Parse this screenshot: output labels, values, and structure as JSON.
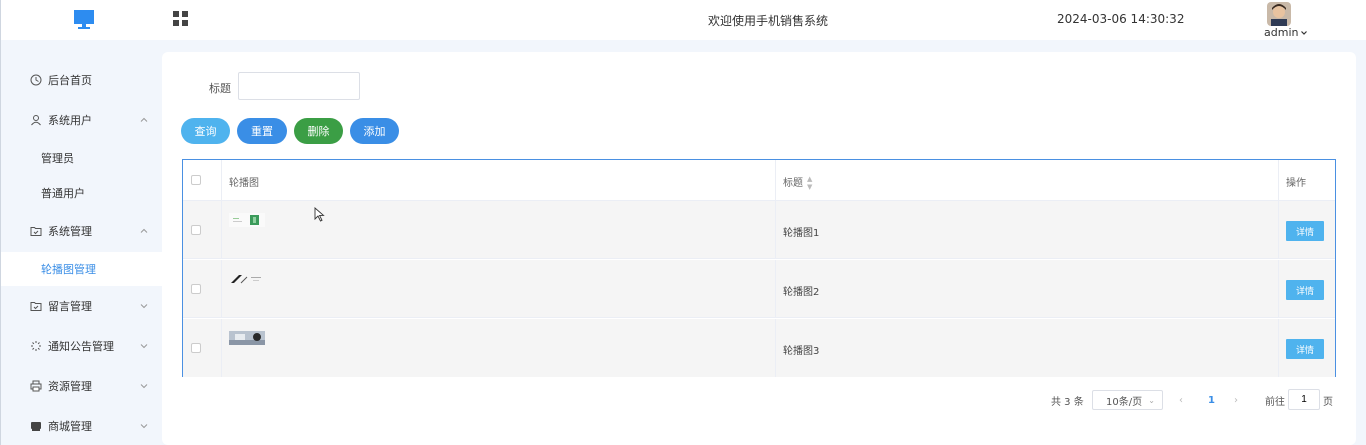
{
  "header": {
    "site_title": "欢迎使用手机销售系统",
    "datetime": "2024-03-06 14:30:32",
    "username": "admin"
  },
  "sidebar": {
    "items": [
      {
        "label": "后台首页",
        "icon": "clock-icon"
      },
      {
        "label": "系统用户",
        "icon": "user-icon",
        "expanded": true
      },
      {
        "label": "管理员"
      },
      {
        "label": "普通用户"
      },
      {
        "label": "系统管理",
        "icon": "folder-icon",
        "expanded": true
      },
      {
        "label": "轮播图管理",
        "active": true
      },
      {
        "label": "留言管理",
        "icon": "folder-icon"
      },
      {
        "label": "通知公告管理",
        "icon": "loading-icon"
      },
      {
        "label": "资源管理",
        "icon": "printer-icon"
      },
      {
        "label": "商城管理",
        "icon": "cart-icon"
      }
    ]
  },
  "filter": {
    "title_label": "标题",
    "title_value": ""
  },
  "actions": {
    "query": "查询",
    "reset": "重置",
    "delete": "删除",
    "add": "添加"
  },
  "table": {
    "headers": {
      "image": "轮播图",
      "title": "标题",
      "op": "操作"
    },
    "rows": [
      {
        "title": "轮播图1",
        "detail": "详情"
      },
      {
        "title": "轮播图2",
        "detail": "详情"
      },
      {
        "title": "轮播图3",
        "detail": "详情"
      }
    ]
  },
  "pagination": {
    "total": "共 3 条",
    "page_size": "10条/页",
    "current_page": "1",
    "goto_label": "前往",
    "goto_value": "1",
    "page_suffix": "页"
  },
  "colors": {
    "primary": "#3a8ee6",
    "info": "#4fb3ee",
    "success": "#3b9e45"
  }
}
